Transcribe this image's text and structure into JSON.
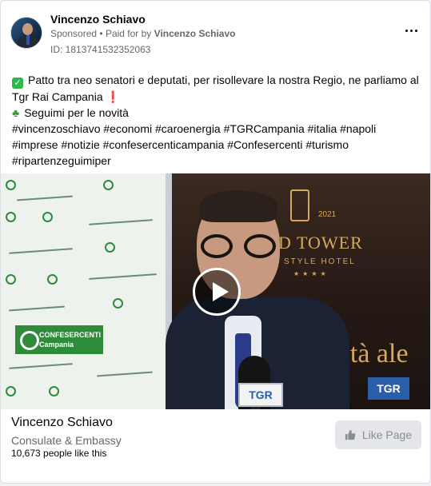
{
  "post": {
    "author": "Vincenzo Schiavo",
    "sponsored": "Sponsored",
    "paid_for_prefix": "Paid for by",
    "paid_for_name": "Vincenzo Schiavo",
    "ad_id": "ID: 1813741532352063",
    "menu_icon": "more-horizontal-icon"
  },
  "text": {
    "line1": "Patto tra neo senatori e deputati, per risollevare la nostra Regio, ne parliamo al",
    "line2": "Tgr Rai Campania",
    "line2_emoji": "❗",
    "line3": "Seguimi per le novità",
    "hashtags_1": "#vincenzoschiavo #economi #caroenergia #TGRCampania #italia #napoli",
    "hashtags_2": "#imprese #notizie #confesercenticampania #Confesercenti #turismo",
    "hashtags_3": "#ripartenzeguimiper"
  },
  "media": {
    "confesercenti_label": "CONFESERCENTI",
    "confesercenti_sub": "Campania",
    "hotel_year": "2021",
    "hotel_name": "D TOWER",
    "hotel_sub": "STYLE HOTEL",
    "hotel_stars": "★★★★",
    "hotel_script": "lità ale",
    "tgr_badge": "TGR",
    "mic_label": "TGR",
    "play_icon": "play-icon"
  },
  "footer": {
    "page_name": "Vincenzo Schiavo",
    "category": "Consulate & Embassy",
    "likes": "10,673 people like this",
    "like_button": "Like Page"
  }
}
